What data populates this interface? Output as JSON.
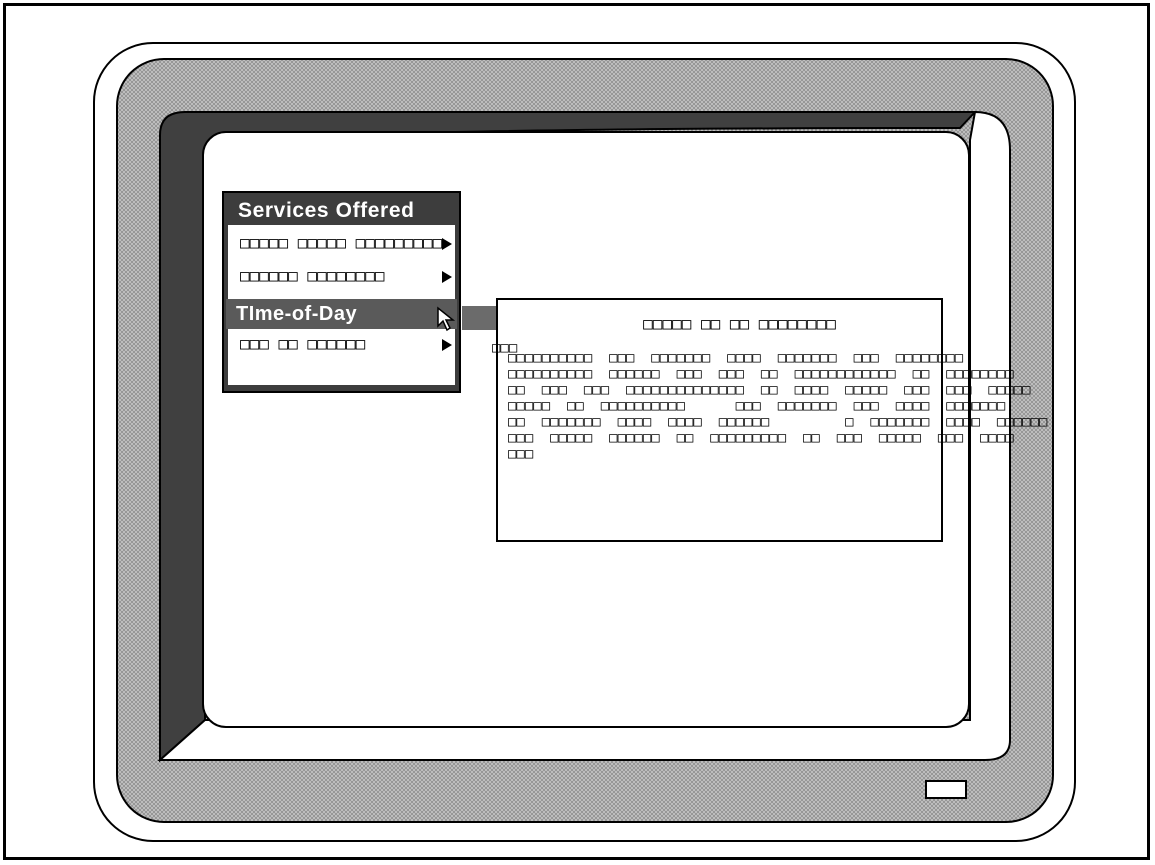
{
  "menu": {
    "title": "Services Offered",
    "items": [
      {
        "label": "□□□□□  □□□□□  □□□□□□□□□",
        "has_submenu": true,
        "selected": false
      },
      {
        "label": "□□□□□□  □□□□□□□□",
        "has_submenu": true,
        "selected": false
      },
      {
        "label": "TIme-of-Day",
        "has_submenu": false,
        "selected": true
      },
      {
        "label": "□□□  □□    □□□□□□",
        "has_submenu": true,
        "selected": false
      }
    ]
  },
  "help": {
    "title": "□□□□□  □□     □□  □□□□□□□□",
    "body": "□□□□□□□□□□  □□□  □□□□□□□  □□□□  □□□□□□□  □□□  □□□□□□□□\n□□□□□□□□□□  □□□□□□  □□□  □□□  □□  □□□□□□□□□□□□  □□  □□□□□□□□\n□□  □□□  □□□  □□□□□□□□□□□□□□  □□  □□□□  □□□□□  □□□  □□□  □□□□□\n□□□□□  □□  □□□□□□□□□□      □□□  □□□□□□□  □□□  □□□□  □□□□□□□\n□□  □□□□□□□  □□□□  □□□□  □□□□□□         □  □□□□□□□  □□□□  □□□□□□\n□□□  □□□□□  □□□□□□  □□  □□□□□□□□□  □□  □□□  □□□□□  □□□  □□□□\n□□□",
    "overflow_label": "□□□"
  }
}
